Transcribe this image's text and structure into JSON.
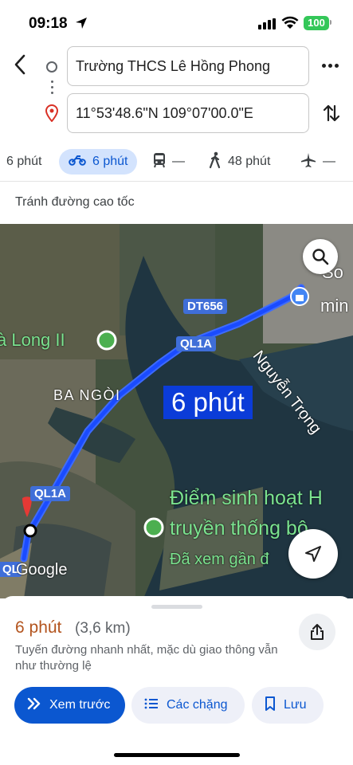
{
  "status_bar": {
    "time": "09:18",
    "battery": "100"
  },
  "route": {
    "origin": "Trường THCS Lê Hồng Phong",
    "destination": "11°53'48.6\"N 109°07'00.0\"E"
  },
  "modes": {
    "car": "6 phút",
    "bike": "6 phút",
    "transit": "—",
    "walk": "48 phút",
    "flight": "—"
  },
  "avoid_option": "Tránh đường cao tốc",
  "map": {
    "labels": {
      "road_dt656": "DT656",
      "road_ql1a_top": "QL1A",
      "road_ql1a_bottom": "QL1A",
      "road_ql_edge": "QL",
      "ba_ngoi": "BA NGÒI",
      "long_ii": "à Long II",
      "nguyen_trong": "Nguyễn Trọng",
      "so": "So",
      "min": "min",
      "route_time": "6 phút",
      "poi_title_line1": "Điểm sinh hoạt H",
      "poi_title_line2": "truyền thống bộ",
      "poi_subtitle": "Đã xem gần đ",
      "google": "Google"
    }
  },
  "sheet": {
    "duration": "6 phút",
    "distance": "(3,6 km)",
    "description": "Tuyến đường nhanh nhất, mặc dù giao thông vẫn như thường lệ",
    "buttons": {
      "preview": "Xem trước",
      "steps": "Các chặng",
      "save": "Lưu"
    }
  },
  "colors": {
    "accent": "#0b57d0",
    "route_line": "#1a5cff",
    "duration": "#b3541e",
    "poi_green": "#7be38f"
  },
  "icons": [
    "location-arrow-icon",
    "signal-icon",
    "wifi-icon",
    "back-arrow-icon",
    "origin-circle-icon",
    "destination-pin-icon",
    "more-icon",
    "swap-icon",
    "car-icon",
    "motorbike-icon",
    "transit-icon",
    "walk-icon",
    "flight-icon",
    "search-icon",
    "navigate-icon",
    "share-icon",
    "double-chevron-icon",
    "list-icon",
    "bookmark-icon"
  ]
}
